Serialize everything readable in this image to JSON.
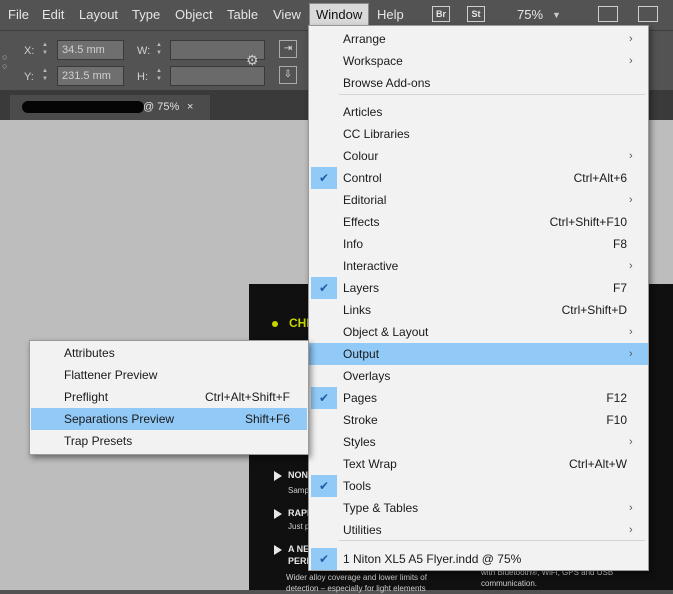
{
  "menubar": {
    "items": [
      "File",
      "Edit",
      "Layout",
      "Type",
      "Object",
      "Table",
      "View",
      "Window",
      "Help"
    ],
    "bridge_icon": "Br",
    "stock_icon": "St",
    "zoom": "75%"
  },
  "control": {
    "x_label": "X:",
    "x_value": "34.5 mm",
    "y_label": "Y:",
    "y_value": "231.5 mm",
    "w_label": "W:",
    "h_label": "H:"
  },
  "document_tab": {
    "zoom": "@ 75%",
    "close": "×"
  },
  "flyer": {
    "heading": "CHE",
    "items": [
      {
        "title": "NON-",
        "sub": "Samp"
      },
      {
        "title": "RAPI",
        "sub": "Just p"
      },
      {
        "title": "A NEV",
        "title2": "PERF",
        "sub": "Wider alloy coverage and lower limits of",
        "sub2": "detection – especially for light elements"
      }
    ],
    "right_sub": "with Bluetooth®, WiFi, GPS and USB",
    "right_sub2": "communication."
  },
  "window_menu": {
    "items": [
      {
        "label": "Arrange",
        "shortcut": "",
        "submenu": true,
        "checked": false
      },
      {
        "label": "Workspace",
        "shortcut": "",
        "submenu": true,
        "checked": false
      },
      {
        "label": "Browse Add-ons",
        "shortcut": "",
        "submenu": false,
        "checked": false
      },
      {
        "label": "Articles",
        "shortcut": "",
        "submenu": false,
        "checked": false
      },
      {
        "label": "CC Libraries",
        "shortcut": "",
        "submenu": false,
        "checked": false
      },
      {
        "label": "Colour",
        "shortcut": "",
        "submenu": true,
        "checked": false
      },
      {
        "label": "Control",
        "shortcut": "Ctrl+Alt+6",
        "submenu": false,
        "checked": true
      },
      {
        "label": "Editorial",
        "shortcut": "",
        "submenu": true,
        "checked": false
      },
      {
        "label": "Effects",
        "shortcut": "Ctrl+Shift+F10",
        "submenu": false,
        "checked": false
      },
      {
        "label": "Info",
        "shortcut": "F8",
        "submenu": false,
        "checked": false
      },
      {
        "label": "Interactive",
        "shortcut": "",
        "submenu": true,
        "checked": false
      },
      {
        "label": "Layers",
        "shortcut": "F7",
        "submenu": false,
        "checked": true
      },
      {
        "label": "Links",
        "shortcut": "Ctrl+Shift+D",
        "submenu": false,
        "checked": false
      },
      {
        "label": "Object & Layout",
        "shortcut": "",
        "submenu": true,
        "checked": false
      },
      {
        "label": "Output",
        "shortcut": "",
        "submenu": true,
        "checked": false,
        "highlighted": true
      },
      {
        "label": "Overlays",
        "shortcut": "",
        "submenu": false,
        "checked": false
      },
      {
        "label": "Pages",
        "shortcut": "F12",
        "submenu": false,
        "checked": true
      },
      {
        "label": "Stroke",
        "shortcut": "F10",
        "submenu": false,
        "checked": false
      },
      {
        "label": "Styles",
        "shortcut": "",
        "submenu": true,
        "checked": false
      },
      {
        "label": "Text Wrap",
        "shortcut": "Ctrl+Alt+W",
        "submenu": false,
        "checked": false
      },
      {
        "label": "Tools",
        "shortcut": "",
        "submenu": false,
        "checked": true
      },
      {
        "label": "Type & Tables",
        "shortcut": "",
        "submenu": true,
        "checked": false
      },
      {
        "label": "Utilities",
        "shortcut": "",
        "submenu": true,
        "checked": false
      },
      {
        "label": "1 Niton XL5 A5 Flyer.indd @ 75%",
        "shortcut": "",
        "submenu": false,
        "checked": true
      }
    ]
  },
  "output_submenu": {
    "items": [
      {
        "label": "Attributes",
        "shortcut": ""
      },
      {
        "label": "Flattener Preview",
        "shortcut": ""
      },
      {
        "label": "Preflight",
        "shortcut": "Ctrl+Alt+Shift+F"
      },
      {
        "label": "Separations Preview",
        "shortcut": "Shift+F6",
        "highlighted": true
      },
      {
        "label": "Trap Presets",
        "shortcut": ""
      }
    ]
  },
  "symbols": {
    "check": "✔",
    "arrow": "›",
    "play": "▶"
  },
  "colors": {
    "highlight": "#91c9f7",
    "menu_bg": "#f2f2f2",
    "chrome": "#535353",
    "flyer_accent": "#c8d400"
  }
}
